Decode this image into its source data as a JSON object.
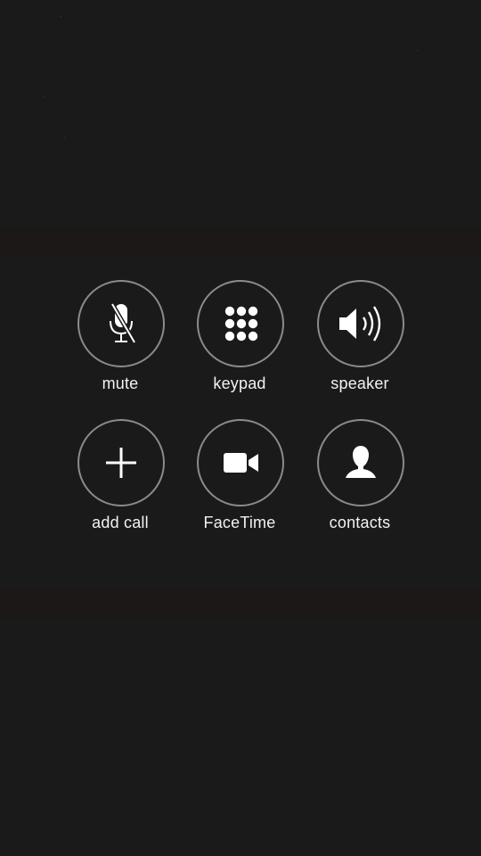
{
  "call_controls": {
    "row1": [
      {
        "id": "mute",
        "label": "mute",
        "icon": "mic-muted-icon"
      },
      {
        "id": "keypad",
        "label": "keypad",
        "icon": "keypad-grid-icon"
      },
      {
        "id": "speaker",
        "label": "speaker",
        "icon": "speaker-icon"
      }
    ],
    "row2": [
      {
        "id": "add-call",
        "label": "add call",
        "icon": "plus-icon"
      },
      {
        "id": "facetime",
        "label": "FaceTime",
        "icon": "video-camera-icon"
      },
      {
        "id": "contacts",
        "label": "contacts",
        "icon": "person-silhouette-icon"
      }
    ]
  },
  "colors": {
    "background": "#1b1a1a",
    "button_ring": "#8f8a89",
    "icon": "#ffffff",
    "label": "#f2f2f2"
  }
}
